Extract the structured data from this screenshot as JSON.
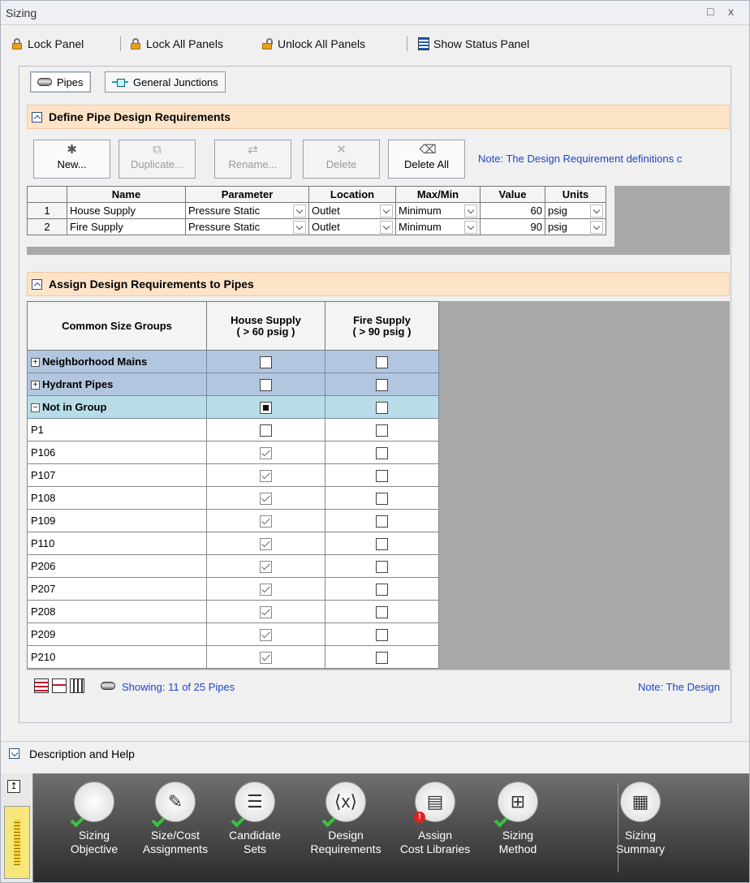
{
  "window": {
    "title": "Sizing",
    "restore_glyph": "□",
    "close_glyph": "x"
  },
  "toolbar": {
    "lock_panel": "Lock Panel",
    "lock_all": "Lock All Panels",
    "unlock_all": "Unlock All Panels",
    "show_status": "Show Status Panel"
  },
  "tabs": {
    "pipes": "Pipes",
    "junctions": "General Junctions"
  },
  "define_section": {
    "title": "Define Pipe Design Requirements",
    "buttons": {
      "new": "New...",
      "duplicate": "Duplicate...",
      "rename": "Rename...",
      "delete": "Delete",
      "delete_all": "Delete All"
    },
    "note": "Note: The Design Requirement definitions c",
    "columns": {
      "name": "Name",
      "parameter": "Parameter",
      "location": "Location",
      "maxmin": "Max/Min",
      "value": "Value",
      "units": "Units"
    },
    "rows": [
      {
        "num": "1",
        "name": "House Supply",
        "parameter": "Pressure Static",
        "location": "Outlet",
        "maxmin": "Minimum",
        "value": "60",
        "units": "psig"
      },
      {
        "num": "2",
        "name": "Fire Supply",
        "parameter": "Pressure Static",
        "location": "Outlet",
        "maxmin": "Minimum",
        "value": "90",
        "units": "psig"
      }
    ]
  },
  "assign_section": {
    "title": "Assign Design Requirements to Pipes",
    "col_groups": "Common Size Groups",
    "col_house_1": "House Supply",
    "col_house_2": "( > 60 psig )",
    "col_fire_1": "Fire Supply",
    "col_fire_2": "( > 90 psig )",
    "groups": [
      {
        "label": "Neighborhood Mains",
        "toggle": "+",
        "house": "off",
        "fire": "off"
      },
      {
        "label": "Hydrant Pipes",
        "toggle": "+",
        "house": "off",
        "fire": "off"
      },
      {
        "label": "Not in Group",
        "toggle": "−",
        "house": "partial",
        "fire": "off"
      }
    ],
    "pipes": [
      {
        "name": "P1",
        "house": "off",
        "fire": "off"
      },
      {
        "name": "P106",
        "house": "on",
        "fire": "off"
      },
      {
        "name": "P107",
        "house": "on",
        "fire": "off"
      },
      {
        "name": "P108",
        "house": "on",
        "fire": "off"
      },
      {
        "name": "P109",
        "house": "on",
        "fire": "off"
      },
      {
        "name": "P110",
        "house": "on",
        "fire": "off"
      },
      {
        "name": "P206",
        "house": "on",
        "fire": "off"
      },
      {
        "name": "P207",
        "house": "on",
        "fire": "off"
      },
      {
        "name": "P208",
        "house": "on",
        "fire": "off"
      },
      {
        "name": "P209",
        "house": "on",
        "fire": "off"
      },
      {
        "name": "P210",
        "house": "on",
        "fire": "off"
      }
    ],
    "showing": "Showing: 11 of 25 Pipes",
    "note": "Note: The Design"
  },
  "description": {
    "label": "Description and Help"
  },
  "nav": {
    "items": [
      {
        "line1": "Sizing",
        "line2": "Objective",
        "status": "ok"
      },
      {
        "line1": "Size/Cost",
        "line2": "Assignments",
        "status": "ok"
      },
      {
        "line1": "Candidate",
        "line2": "Sets",
        "status": "ok"
      },
      {
        "line1": "Design",
        "line2": "Requirements",
        "status": "ok"
      },
      {
        "line1": "Assign",
        "line2": "Cost Libraries",
        "status": "error"
      },
      {
        "line1": "Sizing",
        "line2": "Method",
        "status": "ok"
      },
      {
        "line1": "Sizing",
        "line2": "Summary",
        "status": "none"
      }
    ]
  },
  "colors": {
    "section_header": "#fde3c8",
    "group_row": "#b3c6df",
    "note_text": "#1f45c8",
    "nav_bg": "#3a3a3a"
  }
}
